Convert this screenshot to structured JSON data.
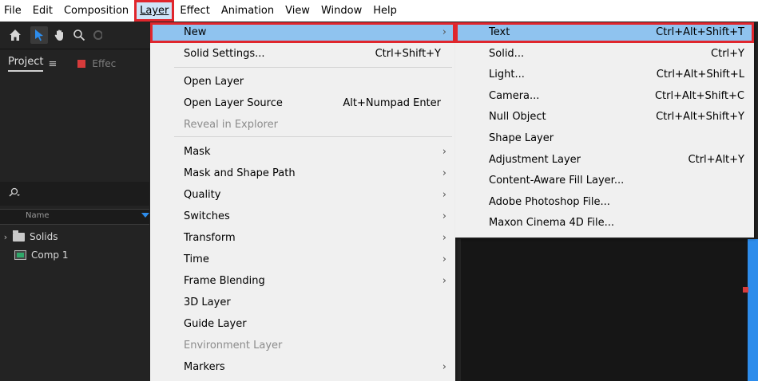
{
  "menubar": [
    "File",
    "Edit",
    "Composition",
    "Layer",
    "Effect",
    "Animation",
    "View",
    "Window",
    "Help"
  ],
  "panel": {
    "project_tab": "Project",
    "effects_tab": "Effec",
    "column_name": "Name"
  },
  "tree": [
    {
      "label": "Solids",
      "type": "folder"
    },
    {
      "label": "Comp 1",
      "type": "composition"
    }
  ],
  "layer_menu": {
    "items": [
      {
        "label": "New",
        "shortcut": "",
        "submenu": true,
        "highlighted": true,
        "disabled": false,
        "sep_after": false
      },
      {
        "label": "Solid Settings...",
        "shortcut": "Ctrl+Shift+Y",
        "submenu": false,
        "disabled": false,
        "sep_after": true
      },
      {
        "label": "Open Layer",
        "shortcut": "",
        "submenu": false,
        "disabled": false,
        "sep_after": false
      },
      {
        "label": "Open Layer Source",
        "shortcut": "Alt+Numpad Enter",
        "submenu": false,
        "disabled": false,
        "sep_after": false
      },
      {
        "label": "Reveal in Explorer",
        "shortcut": "",
        "submenu": false,
        "disabled": true,
        "sep_after": true
      },
      {
        "label": "Mask",
        "shortcut": "",
        "submenu": true,
        "disabled": false,
        "sep_after": false
      },
      {
        "label": "Mask and Shape Path",
        "shortcut": "",
        "submenu": true,
        "disabled": false,
        "sep_after": false
      },
      {
        "label": "Quality",
        "shortcut": "",
        "submenu": true,
        "disabled": false,
        "sep_after": false
      },
      {
        "label": "Switches",
        "shortcut": "",
        "submenu": true,
        "disabled": false,
        "sep_after": false
      },
      {
        "label": "Transform",
        "shortcut": "",
        "submenu": true,
        "disabled": false,
        "sep_after": false
      },
      {
        "label": "Time",
        "shortcut": "",
        "submenu": true,
        "disabled": false,
        "sep_after": false
      },
      {
        "label": "Frame Blending",
        "shortcut": "",
        "submenu": true,
        "disabled": false,
        "sep_after": false
      },
      {
        "label": "3D Layer",
        "shortcut": "",
        "submenu": false,
        "disabled": false,
        "sep_after": false
      },
      {
        "label": "Guide Layer",
        "shortcut": "",
        "submenu": false,
        "disabled": false,
        "sep_after": false
      },
      {
        "label": "Environment Layer",
        "shortcut": "",
        "submenu": false,
        "disabled": true,
        "sep_after": false
      },
      {
        "label": "Markers",
        "shortcut": "",
        "submenu": true,
        "disabled": false,
        "sep_after": false
      }
    ]
  },
  "new_submenu": {
    "items": [
      {
        "label": "Text",
        "shortcut": "Ctrl+Alt+Shift+T",
        "highlighted": true
      },
      {
        "label": "Solid...",
        "shortcut": "Ctrl+Y"
      },
      {
        "label": "Light...",
        "shortcut": "Ctrl+Alt+Shift+L"
      },
      {
        "label": "Camera...",
        "shortcut": "Ctrl+Alt+Shift+C"
      },
      {
        "label": "Null Object",
        "shortcut": "Ctrl+Alt+Shift+Y"
      },
      {
        "label": "Shape Layer",
        "shortcut": ""
      },
      {
        "label": "Adjustment Layer",
        "shortcut": "Ctrl+Alt+Y"
      },
      {
        "label": "Content-Aware Fill Layer...",
        "shortcut": ""
      },
      {
        "label": "Adobe Photoshop File...",
        "shortcut": ""
      },
      {
        "label": "Maxon Cinema 4D File...",
        "shortcut": ""
      }
    ]
  },
  "colors": {
    "highlight": "#8fc3ef",
    "annotation_red": "#e0262d",
    "accent_blue": "#2d8ceb"
  },
  "icons": [
    "home-icon",
    "selection-arrow-icon",
    "hand-icon",
    "zoom-icon",
    "rotate-icon",
    "search-icon",
    "hamburger-icon",
    "submenu-arrow-icon",
    "folder-icon",
    "composition-icon"
  ]
}
